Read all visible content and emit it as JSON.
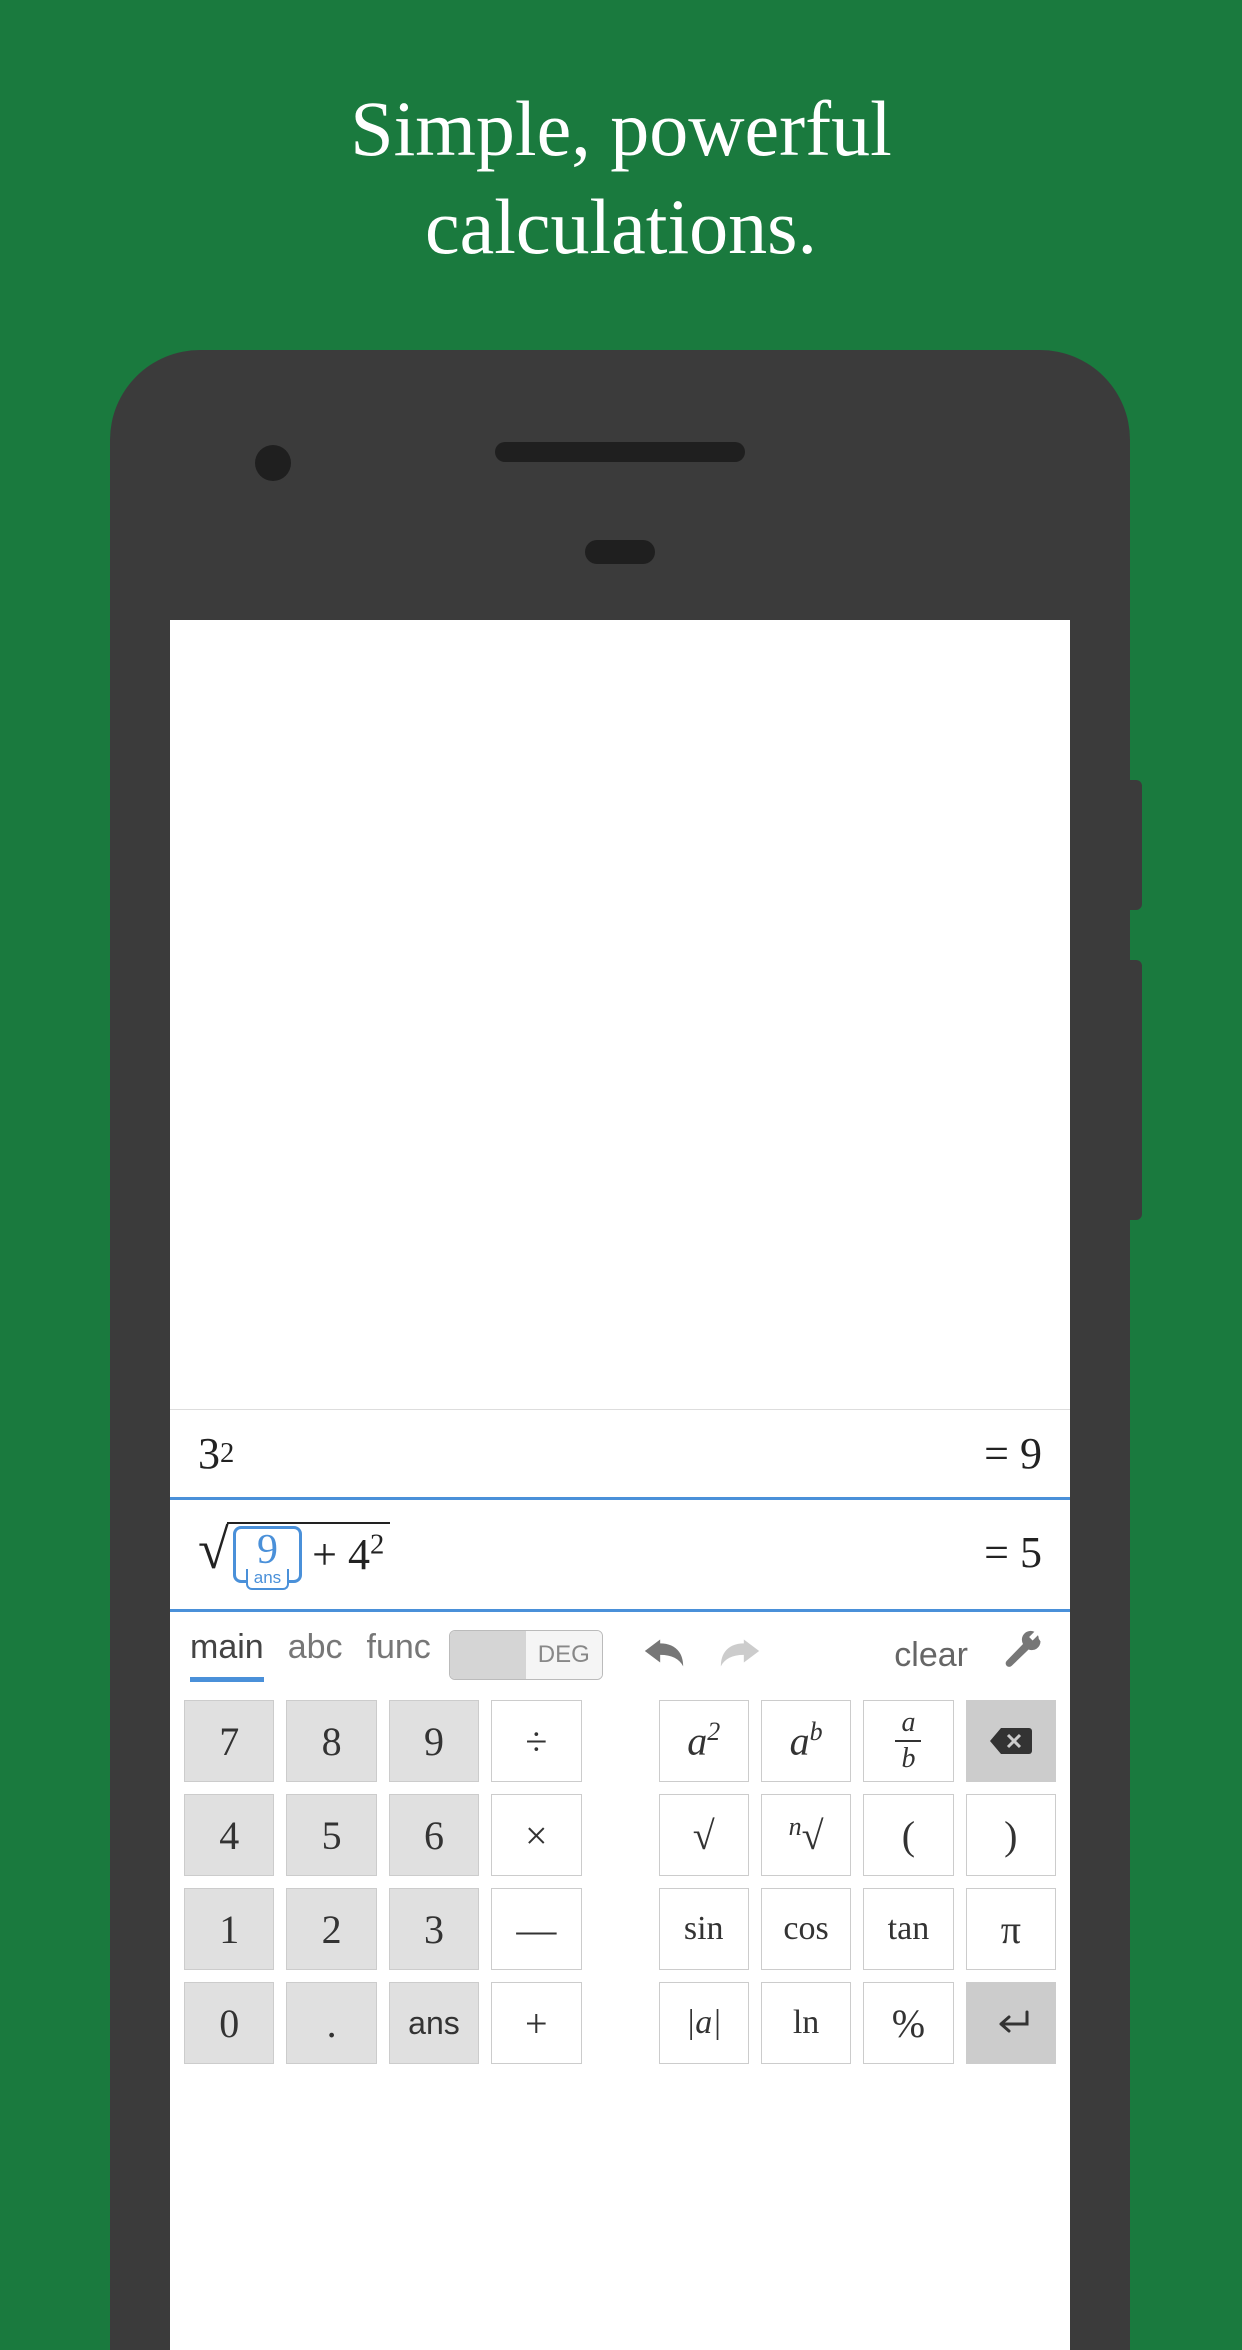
{
  "headline": {
    "line1": "Simple, powerful",
    "line2": "calculations."
  },
  "history": {
    "expr_base": "3",
    "expr_exp": "2",
    "result": "= 9"
  },
  "current": {
    "ans_value": "9",
    "ans_tag": "ans",
    "plus": " + 4",
    "exp": "2",
    "result": "= 5"
  },
  "toolbar": {
    "tabs": {
      "main": "main",
      "abc": "abc",
      "func": "func"
    },
    "mode_deg": "DEG",
    "clear": "clear"
  },
  "keys": {
    "r1": {
      "k7": "7",
      "k8": "8",
      "k9": "9",
      "div": "÷",
      "asq_a": "a",
      "asq_2": "2",
      "apow_a": "a",
      "apow_b": "b",
      "frac_a": "a",
      "frac_b": "b"
    },
    "r2": {
      "k4": "4",
      "k5": "5",
      "k6": "6",
      "mul": "×",
      "sqrt": "√",
      "nroot_n": "n",
      "nroot_sym": "√",
      "lp": "(",
      "rp": ")"
    },
    "r3": {
      "k1": "1",
      "k2": "2",
      "k3": "3",
      "minus": "—",
      "sin": "sin",
      "cos": "cos",
      "tan": "tan",
      "pi": "π"
    },
    "r4": {
      "k0": "0",
      "dot": ".",
      "ans": "ans",
      "plus": "+",
      "abs": "|a|",
      "ln": "ln",
      "pct": "%",
      "enter": "↵"
    }
  }
}
